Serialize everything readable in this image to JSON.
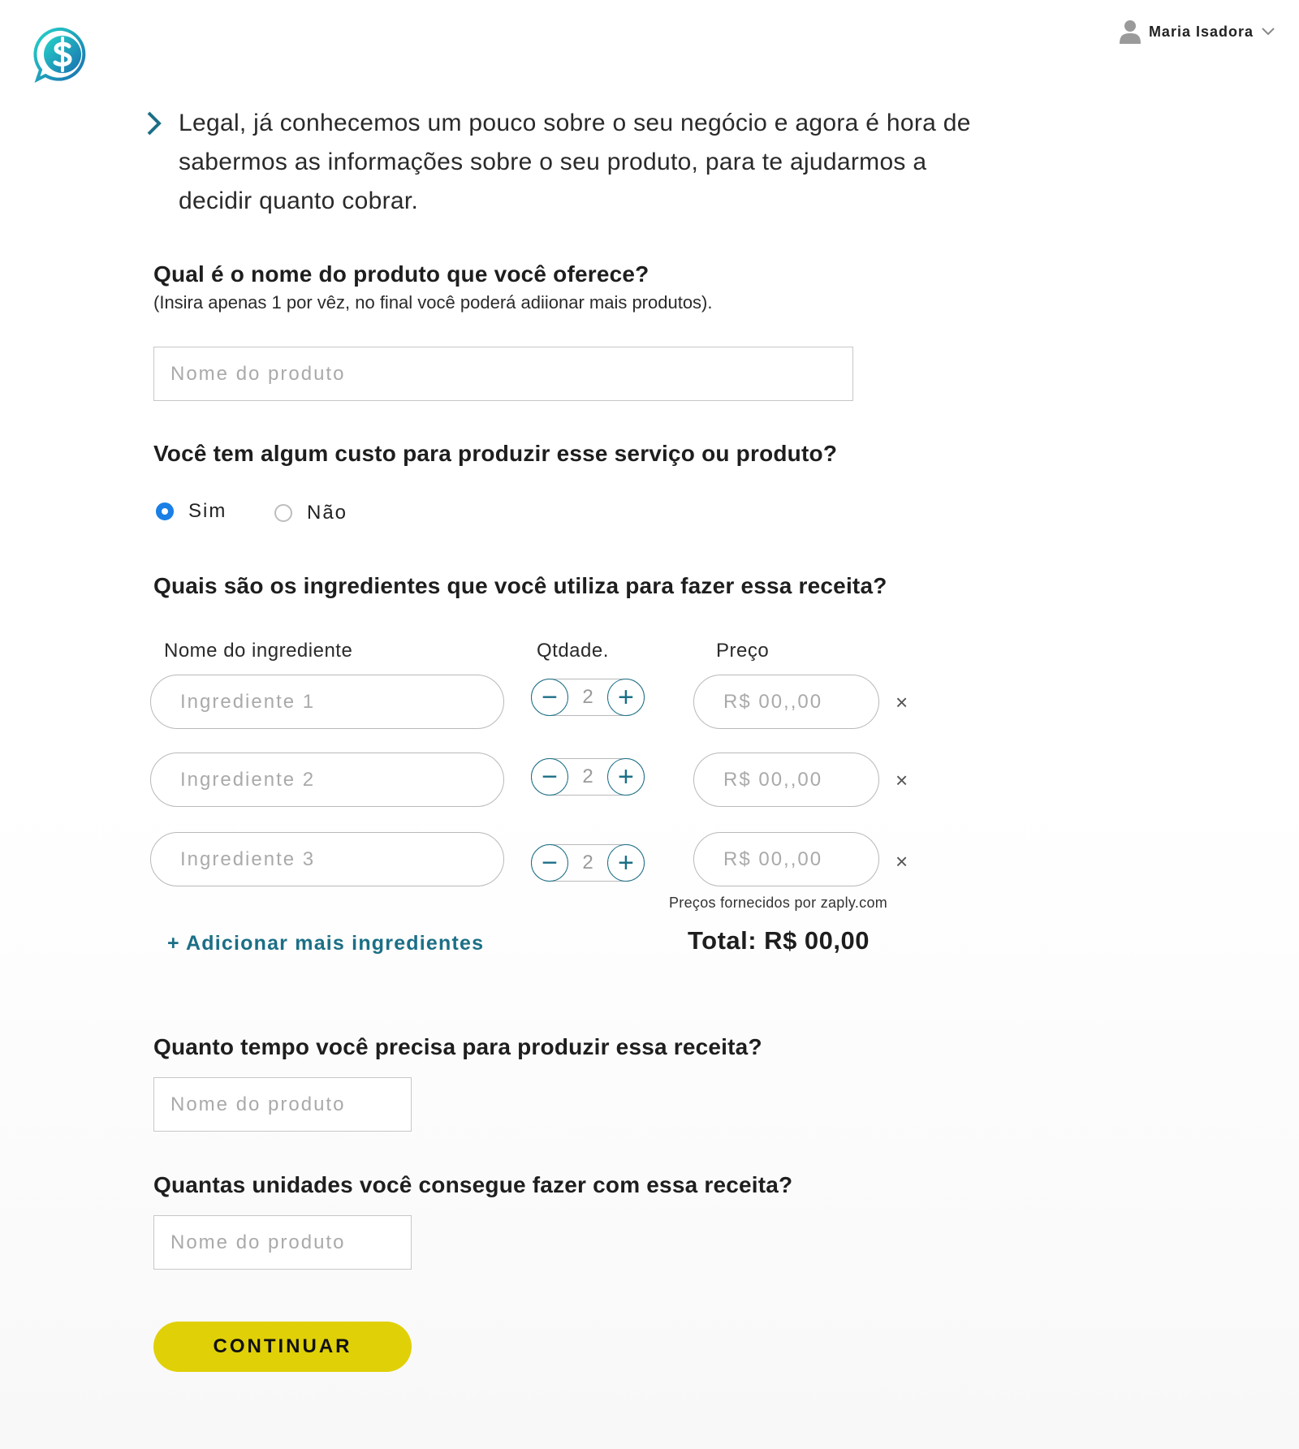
{
  "header": {
    "logo_icon": "dollar-chat-bubble-logo",
    "user_name": "Maria Isadora",
    "user_icon": "user-avatar-icon",
    "dropdown_icon": "chevron-down-icon"
  },
  "intro": {
    "line1": "Legal, já conhecemos um pouco sobre o seu negócio e agora é hora de",
    "line2": "sabermos as informações sobre o seu produto, para te ajudarmos a",
    "line3": "decidir quanto cobrar."
  },
  "product": {
    "question": "Qual é o nome do produto que você oferece?",
    "hint": "(Insira apenas 1 por vêz, no final você poderá adiionar mais produtos).",
    "placeholder": "Nome do produto"
  },
  "cost": {
    "question": "Você tem algum custo para produzir esse serviço ou produto?",
    "options": [
      {
        "label": "Sim",
        "selected": true
      },
      {
        "label": "Não",
        "selected": false
      }
    ]
  },
  "ingredients": {
    "question": "Quais são os ingredientes que você utiliza para fazer essa receita?",
    "col_name": "Nome do ingrediente",
    "col_qty": "Qtdade.",
    "col_price": "Preço",
    "rows": [
      {
        "placeholder": "Ingrediente 1",
        "qty": "2",
        "price_placeholder": "R$ 00,,00"
      },
      {
        "placeholder": "Ingrediente 2",
        "qty": "2",
        "price_placeholder": "R$ 00,,00"
      },
      {
        "placeholder": "Ingrediente 3",
        "qty": "2",
        "price_placeholder": "R$ 00,,00"
      }
    ],
    "minus": "−",
    "plus": "+",
    "remove": "×",
    "prices_note": "Preços fornecidos por zaply.com",
    "add_more": "+ Adicionar mais ingredientes",
    "total": "Total: R$ 00,00"
  },
  "time": {
    "question": "Quanto tempo você precisa para produzir essa receita?",
    "placeholder": "Nome do produto"
  },
  "units": {
    "question": "Quantas unidades você consegue fazer com essa receita?",
    "placeholder": "Nome do produto"
  },
  "continue_label": "CONTINUAR",
  "colors": {
    "accent": "#1b6f86",
    "radio": "#1a7fe6",
    "cta": "#e0d008"
  }
}
